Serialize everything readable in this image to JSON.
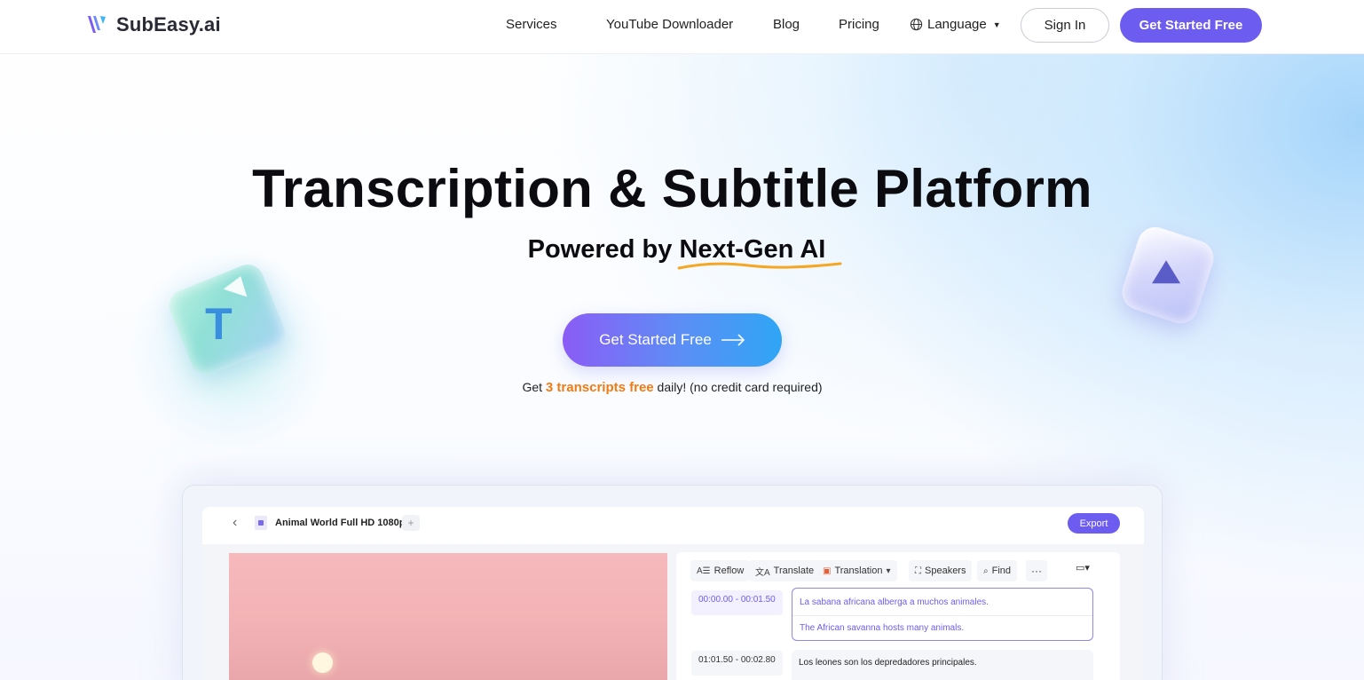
{
  "brand": {
    "name": "SubEasy.ai",
    "logo_icon": "subeasy-logo-icon",
    "accent": "#6d5cf0"
  },
  "nav": {
    "services": "Services",
    "youtube": "YouTube Downloader",
    "blog": "Blog",
    "pricing": "Pricing",
    "language": "Language",
    "sign_in": "Sign In",
    "get_started": "Get Started Free"
  },
  "hero": {
    "title": "Transcription & Subtitle Platform",
    "sub_prefix": "Powered by ",
    "sub_highlight": "Next-Gen AI",
    "cta": "Get Started Free",
    "note_prefix": "Get ",
    "note_accent": "3 transcripts free",
    "note_suffix": " daily! (no credit card required)",
    "note_accent_color": "#f07b12"
  },
  "decor": {
    "left_cube_letter": "T"
  },
  "app": {
    "file_name": "Animal World Full HD 1080p",
    "plus": "+",
    "export": "Export",
    "toolbar": {
      "reflow": "Reflow",
      "translate": "Translate",
      "translation": "Translation",
      "speakers": "Speakers",
      "find": "Find",
      "more": "···"
    },
    "segments": [
      {
        "time": "00:00.00 - 00:01.50",
        "text": "La sabana africana alberga a muchos animales.",
        "translation": "The African savanna hosts many animals."
      },
      {
        "time": "01:01.50 - 00:02.80",
        "text": "Los leones son los depredadores principales."
      }
    ]
  }
}
